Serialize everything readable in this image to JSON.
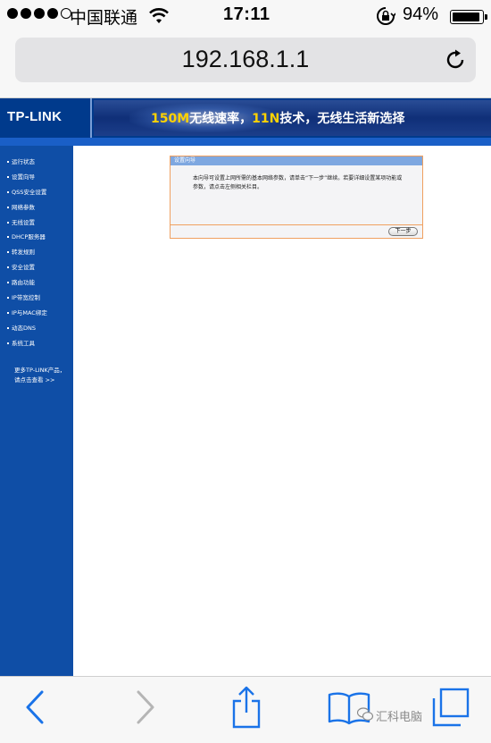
{
  "status_bar": {
    "carrier": "中国联通",
    "time": "17:11",
    "battery_percent": "94%",
    "battery_level": 0.94,
    "signal_bars_filled": 4,
    "signal_bars_total": 5
  },
  "browser": {
    "url": "192.168.1.1"
  },
  "header": {
    "logo_text": "TP-LINK",
    "slogan_highlight_1": "150M",
    "slogan_part_1": "无线速率，",
    "slogan_highlight_2": "11N",
    "slogan_part_2": "技术，无线生活新选择"
  },
  "sidebar": {
    "items": [
      {
        "label": "运行状态"
      },
      {
        "label": "设置向导"
      },
      {
        "label": "QSS安全设置"
      },
      {
        "label": "网络参数"
      },
      {
        "label": "无线设置"
      },
      {
        "label": "DHCP服务器"
      },
      {
        "label": "转发规则"
      },
      {
        "label": "安全设置"
      },
      {
        "label": "路由功能"
      },
      {
        "label": "IP带宽控制"
      },
      {
        "label": "IP与MAC绑定"
      },
      {
        "label": "动态DNS"
      },
      {
        "label": "系统工具"
      }
    ],
    "more_line1": "更多TP-LINK产品，",
    "more_line2": "请点击查看 >>"
  },
  "wizard": {
    "title": "设置向导",
    "body": "本向导可设置上网所需的基本网络参数，请单击“下一步”继续。若要详细设置某项功能或参数，请点击左侧相关栏目。",
    "next_label": "下一步"
  },
  "watermark": {
    "text": "汇科电脑"
  },
  "colors": {
    "tp_blue": "#003a8c",
    "sidebar_blue": "#0f4ea6",
    "ios_blue": "#1a73e8",
    "dialog_border": "#f0a060",
    "slogan_highlight": "#ffd200"
  }
}
